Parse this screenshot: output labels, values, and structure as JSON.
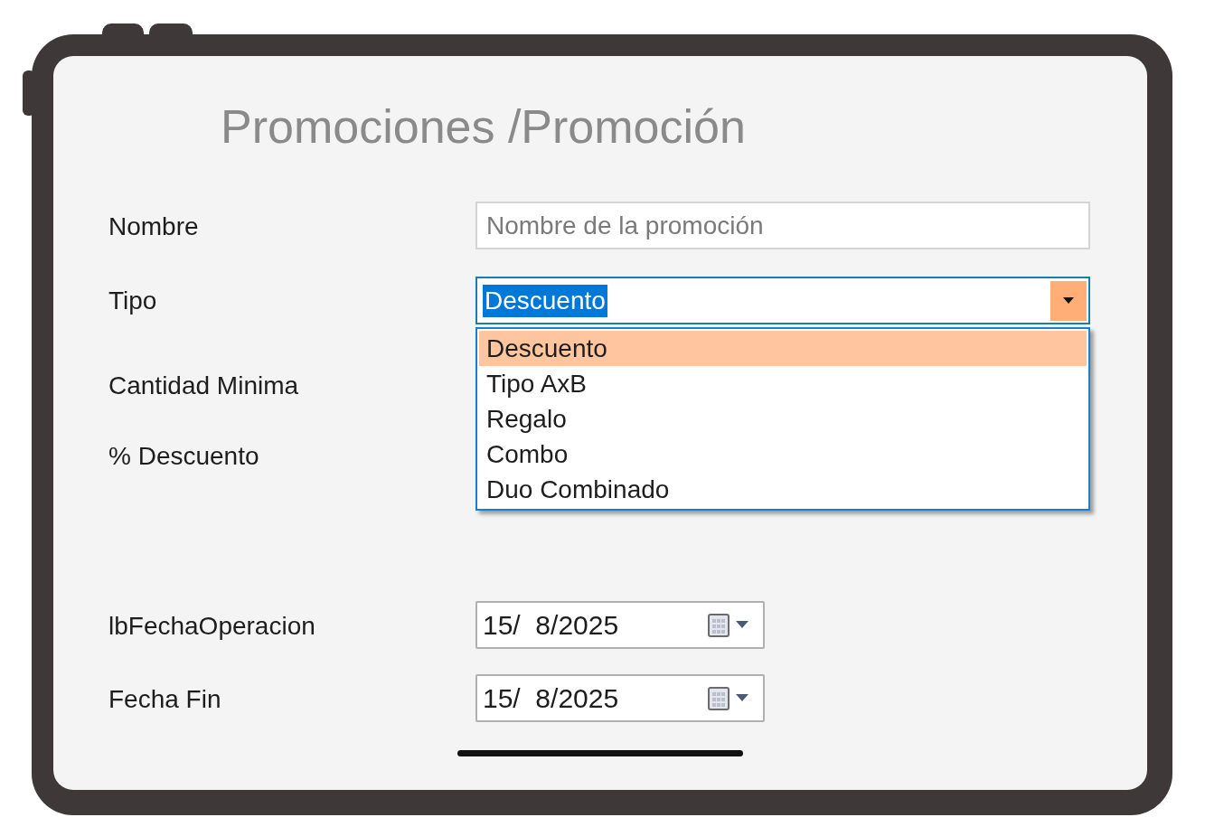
{
  "title": "Promociones /Promoción",
  "fields": [
    {
      "kind": "text",
      "label": "Nombre",
      "placeholder": "Nombre de la promoción"
    },
    {
      "kind": "combo",
      "label": "Tipo",
      "value": "Descuento",
      "expanded": true,
      "options": [
        {
          "label": "Descuento",
          "selected": true
        },
        {
          "label": "Tipo AxB",
          "selected": false
        },
        {
          "label": "Regalo",
          "selected": false
        },
        {
          "label": "Combo",
          "selected": false
        },
        {
          "label": "Duo Combinado",
          "selected": false
        }
      ]
    },
    {
      "kind": "label",
      "label": "Cantidad Minima"
    },
    {
      "kind": "label",
      "label": "% Descuento"
    },
    {
      "kind": "date",
      "label": "lbFechaOperacion",
      "value": "15/  8/2025"
    },
    {
      "kind": "date",
      "label": "Fecha Fin",
      "value": "15/  8/2025"
    }
  ]
}
